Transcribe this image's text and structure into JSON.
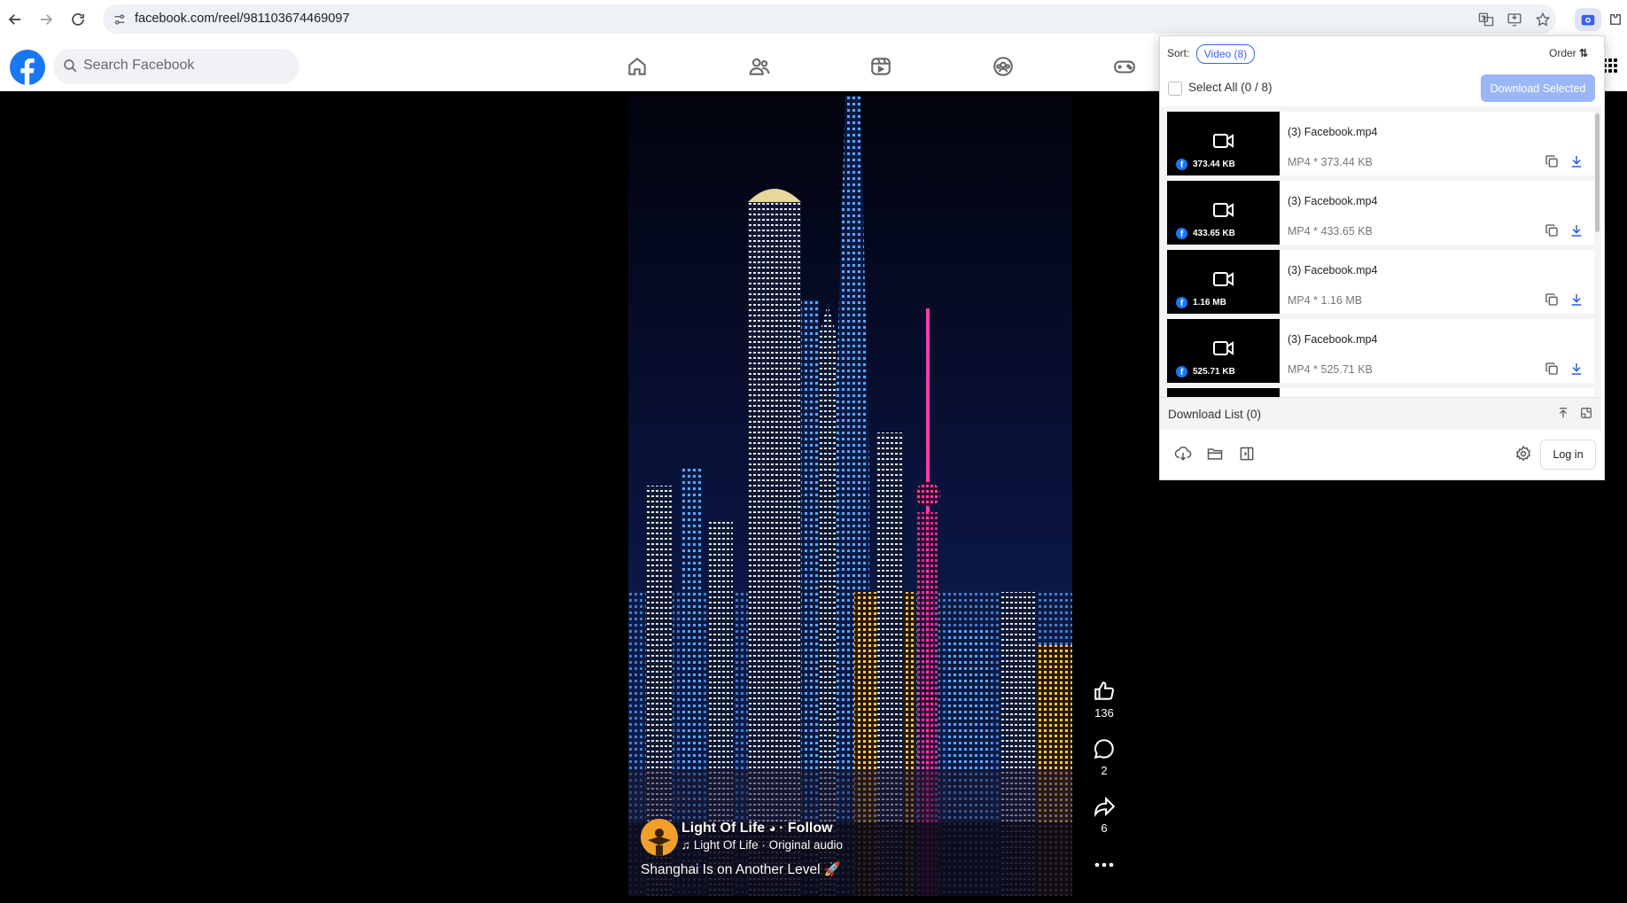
{
  "browser": {
    "url": "facebook.com/reel/981103674469097"
  },
  "facebook": {
    "search_placeholder": "Search Facebook",
    "brand_color": "#1877f2"
  },
  "reel": {
    "author": "Light Of Life",
    "follow_label": "Follow",
    "audio": "Light Of Life · Original audio",
    "caption": "Shanghai Is on Another Level 🚀",
    "likes": "136",
    "comments": "2",
    "shares": "6"
  },
  "extension": {
    "sort_label": "Sort:",
    "sort_chip": "Video (8)",
    "order_label": "Order",
    "select_all_label": "Select All (0 / 8)",
    "download_selected_label": "Download Selected",
    "accent_color": "#3a63ec",
    "items": [
      {
        "title": "(3) Facebook.mp4",
        "size": "373.44 KB",
        "meta": "MP4 * 373.44 KB"
      },
      {
        "title": "(3) Facebook.mp4",
        "size": "433.65 KB",
        "meta": "MP4 * 433.65 KB"
      },
      {
        "title": "(3) Facebook.mp4",
        "size": "1.16 MB",
        "meta": "MP4 * 1.16 MB"
      },
      {
        "title": "(3) Facebook.mp4",
        "size": "525.71 KB",
        "meta": "MP4 * 525.71 KB"
      }
    ],
    "download_list_label": "Download List (0)",
    "login_label": "Log in"
  }
}
